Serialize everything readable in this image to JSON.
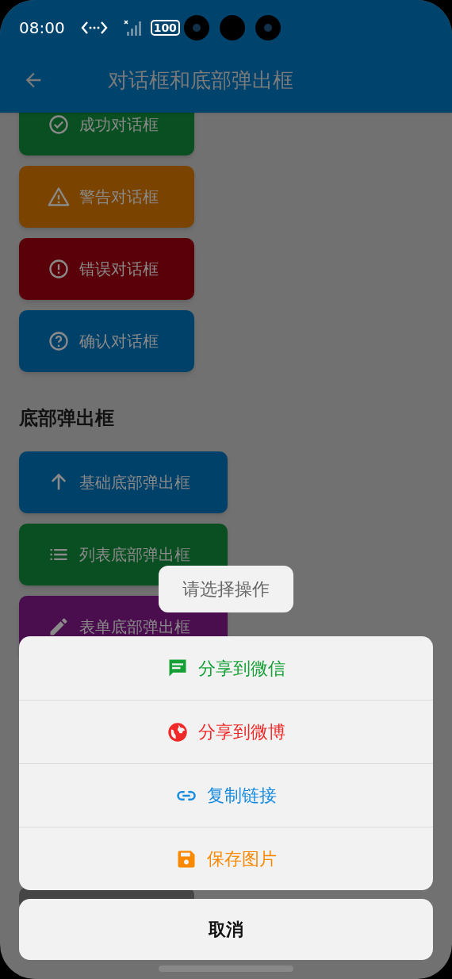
{
  "status_bar": {
    "time": "08:00",
    "battery": "100"
  },
  "app_bar": {
    "title": "对话框和底部弹出框"
  },
  "dialog_buttons": [
    {
      "label": "成功对话框",
      "kind": "check",
      "color": "#0a4f22"
    },
    {
      "label": "警告对话框",
      "kind": "warning",
      "color": "#7a4400"
    },
    {
      "label": "错误对话框",
      "kind": "error",
      "color": "#5a0009"
    },
    {
      "label": "确认对话框",
      "kind": "help",
      "color": "#004169"
    }
  ],
  "section_title": "底部弹出框",
  "sheet_buttons": [
    {
      "label": "基础底部弹出框",
      "kind": "arrow",
      "color": "#004169"
    },
    {
      "label": "列表底部弹出框",
      "kind": "list",
      "color": "#0a4f22"
    },
    {
      "label": "表单底部弹出框",
      "kind": "pencil",
      "color": "#4a0e4e"
    }
  ],
  "toast": "请选择操作",
  "action_sheet": {
    "options": [
      {
        "label": "分享到微信",
        "kind": "chat",
        "color": "#15a035"
      },
      {
        "label": "分享到微博",
        "kind": "globe",
        "color": "#f02828"
      },
      {
        "label": "复制链接",
        "kind": "link",
        "color": "#1a8ce0"
      },
      {
        "label": "保存图片",
        "kind": "save",
        "color": "#f98a00"
      }
    ],
    "cancel": "取消"
  }
}
